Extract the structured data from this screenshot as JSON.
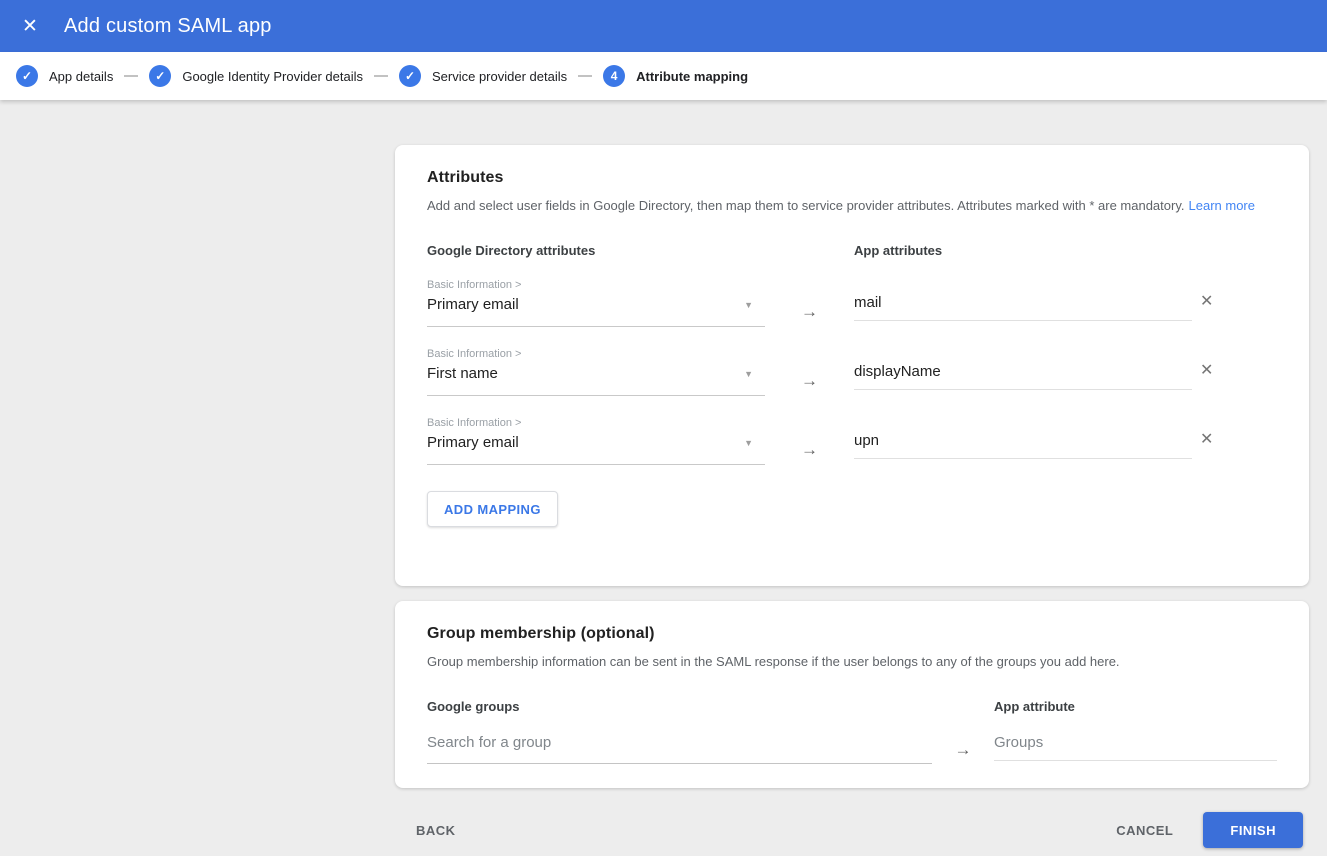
{
  "app_bar": {
    "title": "Add custom SAML app"
  },
  "icons": {
    "close": "✕",
    "check": "✓",
    "chevron_down": "▼",
    "arrow_right": "→",
    "delete": "✕"
  },
  "colors": {
    "header_blue": "#3b6fd9",
    "step_blue": "#3b78e7",
    "link_blue": "#4285f4",
    "background_gray": "#ededed"
  },
  "stepper": {
    "steps": [
      {
        "label": "App details",
        "state": "complete"
      },
      {
        "label": "Google Identity Provider details",
        "state": "complete"
      },
      {
        "label": "Service provider details",
        "state": "complete"
      },
      {
        "label": "Attribute mapping",
        "state": "current",
        "number": "4"
      }
    ]
  },
  "attributes_card": {
    "title": "Attributes",
    "description": "Add and select user fields in Google Directory, then map them to service provider attributes. Attributes marked with * are mandatory.",
    "learn_more_label": "Learn more",
    "left_header": "Google Directory attributes",
    "right_header": "App attributes",
    "mappings": [
      {
        "category": "Basic Information >",
        "field": "Primary email",
        "app_attribute": "mail"
      },
      {
        "category": "Basic Information >",
        "field": "First name",
        "app_attribute": "displayName"
      },
      {
        "category": "Basic Information >",
        "field": "Primary email",
        "app_attribute": "upn"
      }
    ],
    "add_mapping_label": "ADD MAPPING"
  },
  "group_card": {
    "title": "Group membership (optional)",
    "description": "Group membership information can be sent in the SAML response if the user belongs to any of the groups you add here.",
    "left_header": "Google groups",
    "right_header": "App attribute",
    "search_placeholder": "Search for a group",
    "app_attribute_placeholder": "Groups"
  },
  "footer": {
    "back_label": "BACK",
    "cancel_label": "CANCEL",
    "finish_label": "FINISH"
  }
}
